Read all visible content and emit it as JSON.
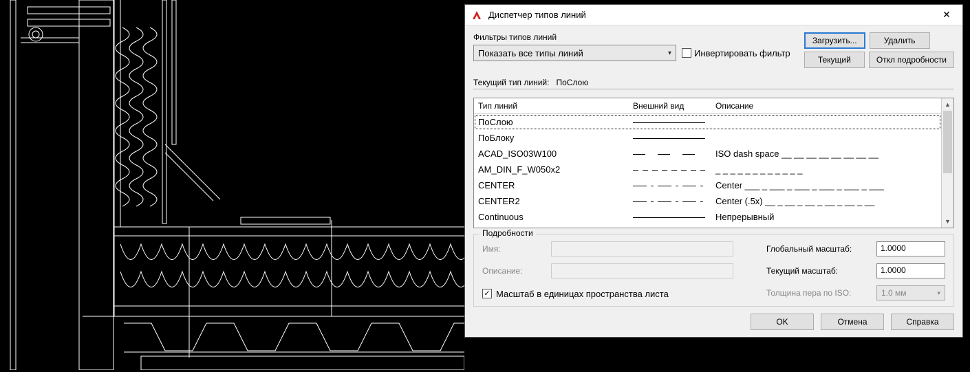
{
  "dialog": {
    "title": "Диспетчер типов линий",
    "close_glyph": "✕"
  },
  "filter": {
    "group_label": "Фильтры типов линий",
    "combo_value": "Показать все типы линий",
    "invert_label": "Инвертировать фильтр",
    "invert_checked": false
  },
  "buttons": {
    "load": "Загрузить...",
    "delete": "Удалить",
    "current": "Текущий",
    "toggle_details": "Откл подробности",
    "ok": "OK",
    "cancel": "Отмена",
    "help": "Справка"
  },
  "current_linetype": {
    "label": "Текущий тип линий:",
    "value": "ПоСлою"
  },
  "table": {
    "headers": {
      "name": "Тип линий",
      "look": "Внешний вид",
      "desc": "Описание"
    },
    "rows": [
      {
        "name": "ПоСлою",
        "style": "solid",
        "desc": "",
        "selected": true
      },
      {
        "name": "ПоБлоку",
        "style": "solid",
        "desc": ""
      },
      {
        "name": "ACAD_ISO03W100",
        "style": "dash2",
        "desc": "ISO dash space __  __  __  __  __  __  __  __"
      },
      {
        "name": "AM_DIN_F_W050x2",
        "style": "shortdash",
        "desc": "_ _ _ _ _ _ _ _ _ _ _ _"
      },
      {
        "name": "CENTER",
        "style": "centerln",
        "desc": "Center ___ _ ___ _ ___ _ ___ _ ___ _ ___"
      },
      {
        "name": "CENTER2",
        "style": "centerln",
        "desc": "Center (.5x) __ _ __ _ __ _ __ _ __ _ __"
      },
      {
        "name": "Continuous",
        "style": "solid",
        "desc": "Непрерывный"
      }
    ]
  },
  "details": {
    "legend": "Подробности",
    "name_label": "Имя:",
    "name_value": "",
    "desc_label": "Описание:",
    "desc_value": "",
    "global_scale_label": "Глобальный масштаб:",
    "global_scale_value": "1.0000",
    "current_scale_label": "Текущий масштаб:",
    "current_scale_value": "1.0000",
    "pen_width_label": "Толщина пера по ISO:",
    "pen_width_value": "1.0 мм",
    "paperspace_units_label": "Масштаб в единицах пространства листа",
    "paperspace_units_checked": true
  }
}
